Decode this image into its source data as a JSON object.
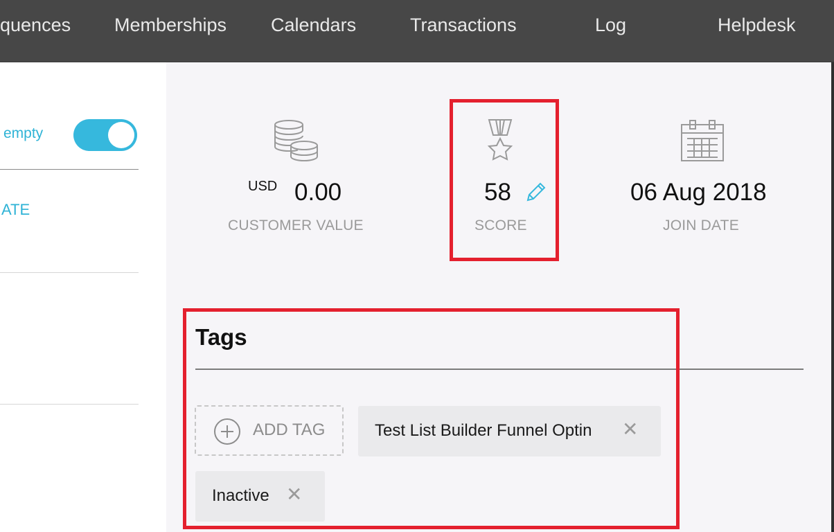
{
  "nav": {
    "items": [
      "quences",
      "Memberships",
      "Calendars",
      "Transactions",
      "Log",
      "Helpdesk"
    ]
  },
  "sidebar": {
    "toggle_label": "empty",
    "toggle_on": true,
    "link_label": "ATE"
  },
  "stats": {
    "customer_value": {
      "currency": "USD",
      "value": "0.00",
      "label": "CUSTOMER VALUE"
    },
    "score": {
      "value": "58",
      "label": "SCORE"
    },
    "join_date": {
      "value": "06 Aug 2018",
      "label": "JOIN DATE"
    }
  },
  "tags": {
    "title": "Tags",
    "add_label": "ADD TAG",
    "items": [
      "Test List Builder Funnel Optin",
      "Inactive"
    ]
  },
  "colors": {
    "accent": "#36b8dd",
    "highlight": "#e4202e",
    "topbar": "#474747"
  }
}
